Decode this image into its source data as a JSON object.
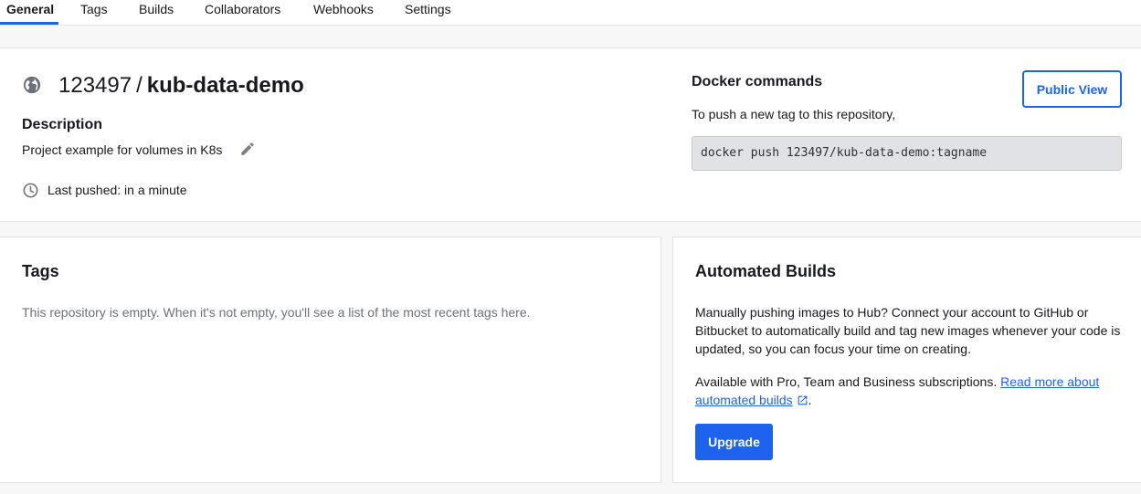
{
  "tabs": [
    {
      "label": "General",
      "active": true
    },
    {
      "label": "Tags"
    },
    {
      "label": "Builds"
    },
    {
      "label": "Collaborators"
    },
    {
      "label": "Webhooks"
    },
    {
      "label": "Settings"
    }
  ],
  "repo": {
    "namespace": "123497",
    "separator": "/",
    "name": "kub-data-demo",
    "visibility_icon": "globe-icon",
    "description_heading": "Description",
    "description": "Project example for volumes in K8s",
    "last_pushed": "Last pushed: in a minute"
  },
  "docker": {
    "heading": "Docker commands",
    "help": "To push a new tag to this repository,",
    "command": "docker push 123497/kub-data-demo:tagname",
    "public_view_label": "Public View"
  },
  "tags_section": {
    "heading": "Tags",
    "empty_text": "This repository is empty. When it's not empty, you'll see a list of the most recent tags here."
  },
  "builds_section": {
    "heading": "Automated Builds",
    "text": "Manually pushing images to Hub? Connect your account to GitHub or Bitbucket to automatically build and tag new images whenever your code is updated, so you can focus your time on creating.",
    "availability": "Available with Pro, Team and Business subscriptions.",
    "link_text": "Read more about automated builds",
    "link_suffix": ".",
    "upgrade_label": "Upgrade"
  },
  "colors": {
    "accent": "#1d63ed",
    "muted_text": "#6c717a",
    "page_background": "#f7f7f8"
  }
}
